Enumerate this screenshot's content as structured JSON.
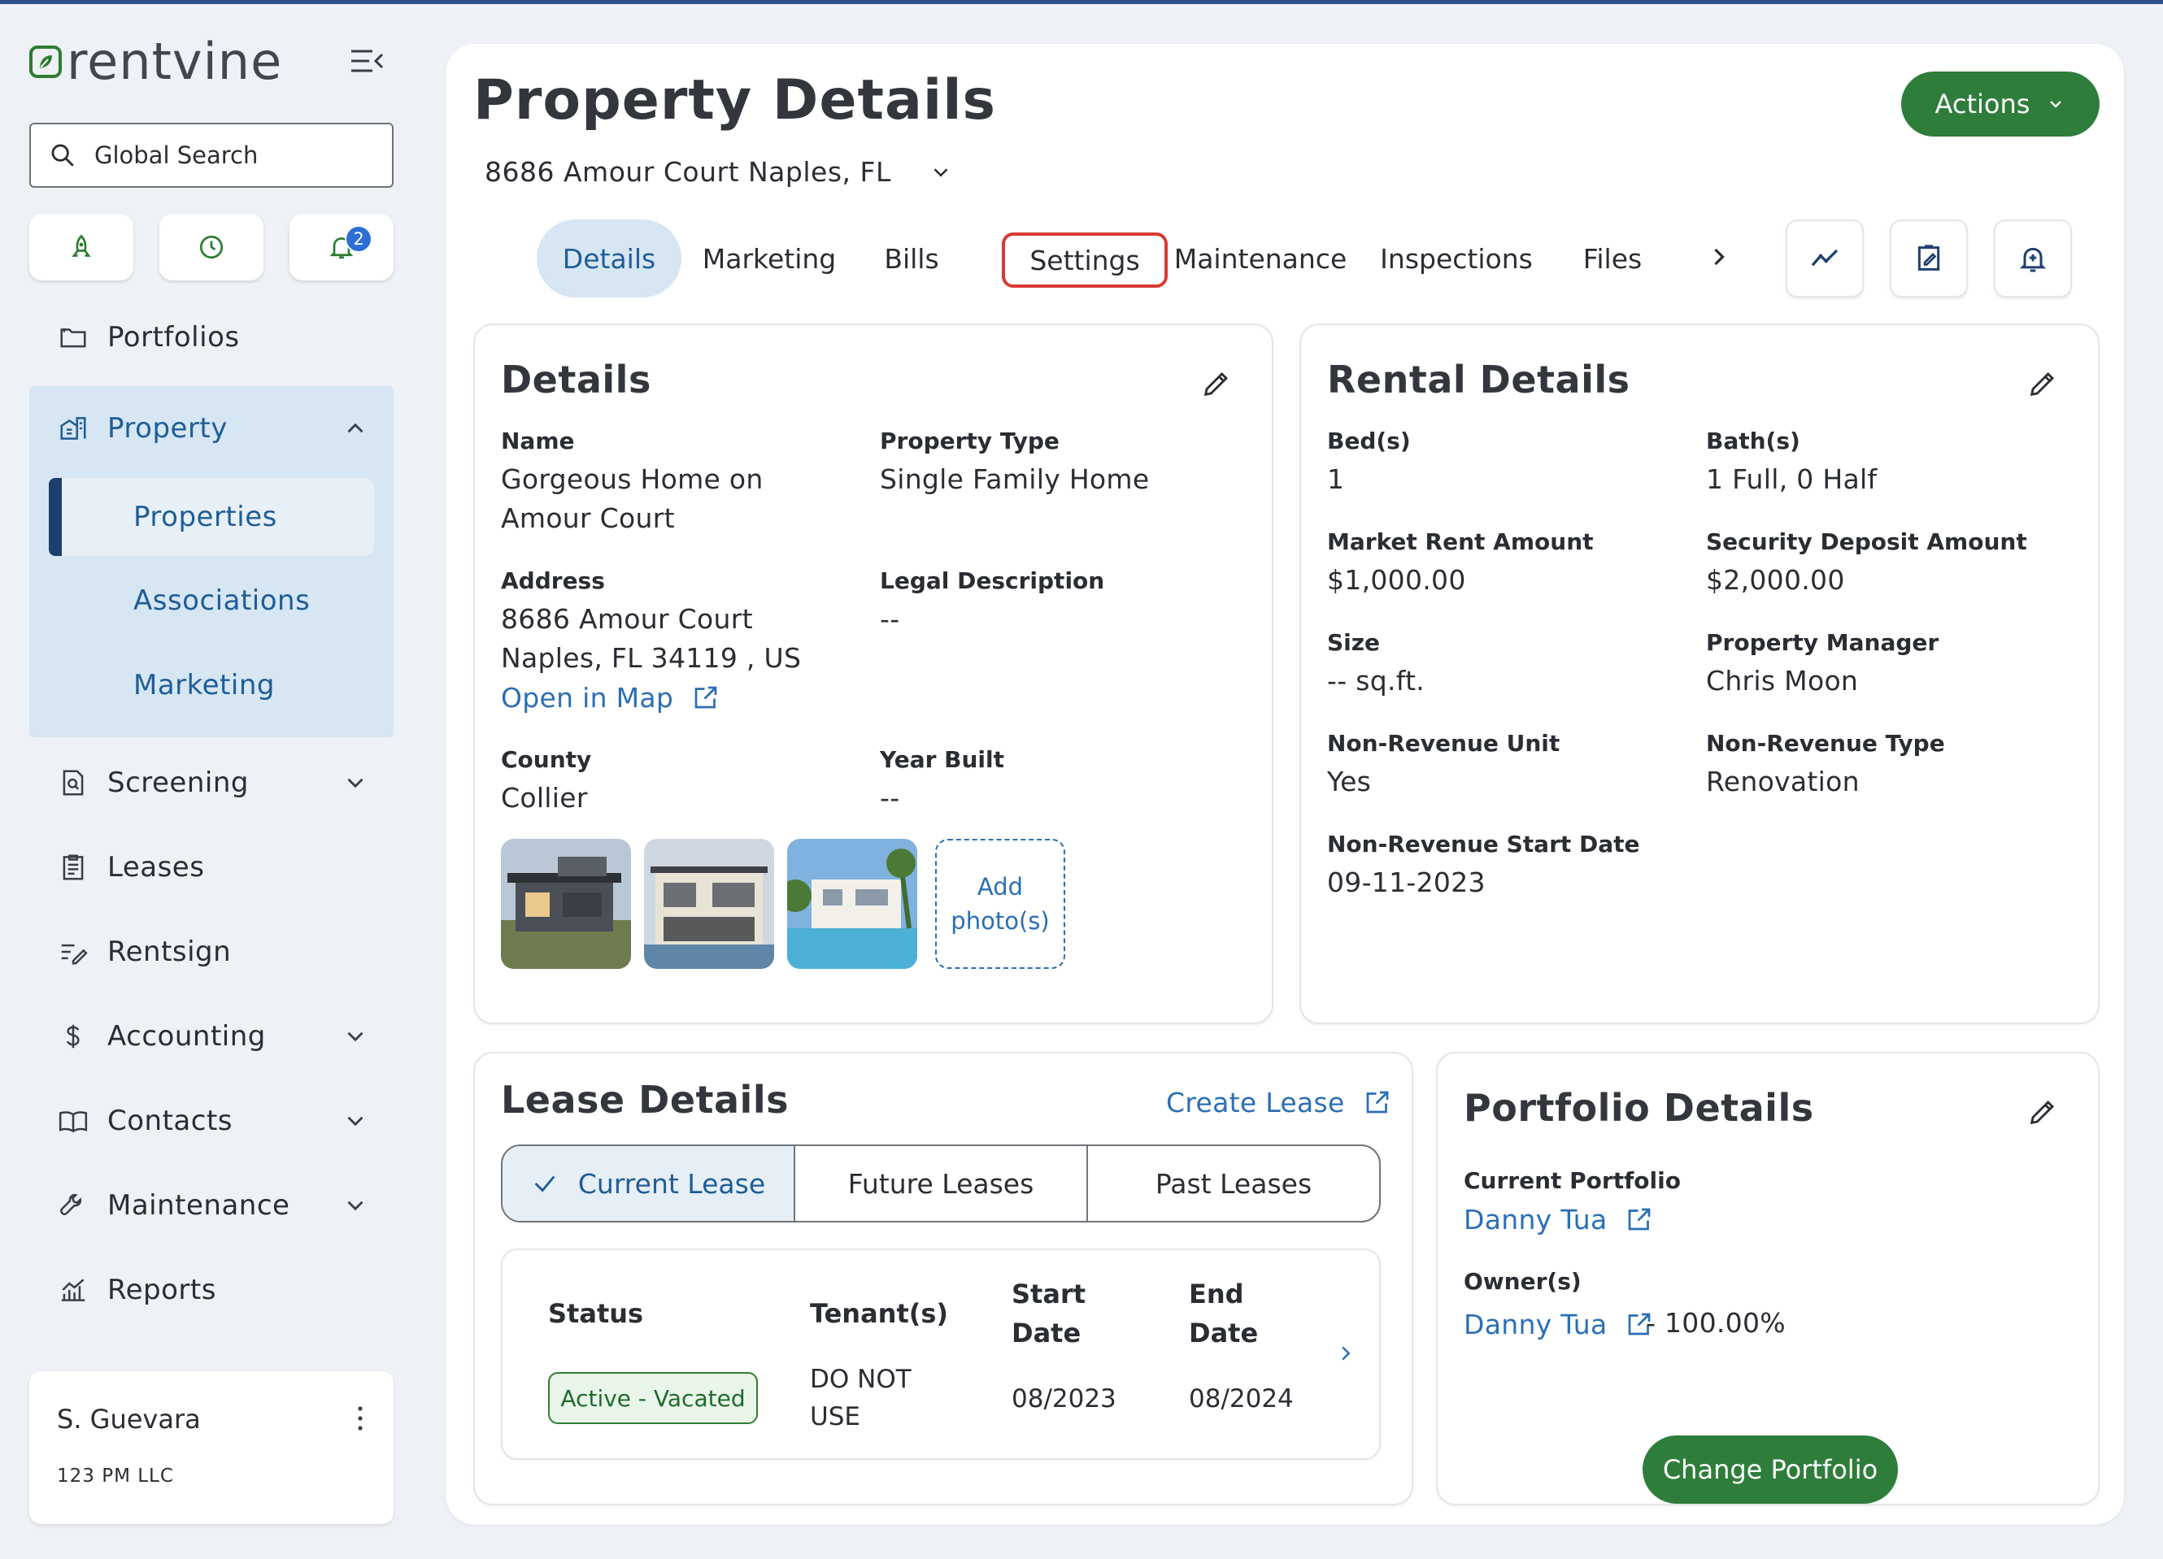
{
  "app": {
    "brand": "rentvine",
    "brand_color": "#2e7d32",
    "accent_color": "#2b6fb5"
  },
  "sidebar": {
    "search_label": "Global Search",
    "notification_count": "2",
    "nav": {
      "portfolios": "Portfolios",
      "property": "Property",
      "properties": "Properties",
      "associations": "Associations",
      "marketing": "Marketing",
      "screening": "Screening",
      "leases": "Leases",
      "rentsign": "Rentsign",
      "accounting": "Accounting",
      "contacts": "Contacts",
      "maintenance": "Maintenance",
      "reports": "Reports"
    },
    "user": {
      "name": "S. Guevara",
      "org": "123 PM LLC"
    }
  },
  "header": {
    "title": "Property Details",
    "address": "8686 Amour Court Naples, FL",
    "actions_label": "Actions"
  },
  "tabs": {
    "details": "Details",
    "marketing": "Marketing",
    "bills": "Bills",
    "settings": "Settings",
    "maintenance": "Maintenance",
    "inspections": "Inspections",
    "files": "Files"
  },
  "details_card": {
    "title": "Details",
    "name_label": "Name",
    "name_value": "Gorgeous Home on Amour Court",
    "type_label": "Property Type",
    "type_value": "Single Family Home",
    "address_label": "Address",
    "address_line1": "8686 Amour Court",
    "address_line2": "Naples, FL 34119 , US",
    "map_link": "Open in Map",
    "legal_label": "Legal Description",
    "legal_value": "--",
    "county_label": "County",
    "county_value": "Collier",
    "year_label": "Year Built",
    "year_value": "--",
    "add_photo": "Add photo(s)"
  },
  "rental_card": {
    "title": "Rental Details",
    "beds_label": "Bed(s)",
    "beds_value": "1",
    "baths_label": "Bath(s)",
    "baths_value": "1 Full, 0 Half",
    "rent_label": "Market Rent Amount",
    "rent_value": "$1,000.00",
    "deposit_label": "Security Deposit Amount",
    "deposit_value": "$2,000.00",
    "size_label": "Size",
    "size_value": "-- sq.ft.",
    "manager_label": "Property Manager",
    "manager_value": "Chris Moon",
    "nonrev_unit_label": "Non-Revenue Unit",
    "nonrev_unit_value": "Yes",
    "nonrev_type_label": "Non-Revenue Type",
    "nonrev_type_value": "Renovation",
    "nonrev_start_label": "Non-Revenue Start Date",
    "nonrev_start_value": "09-11-2023"
  },
  "lease_card": {
    "title": "Lease Details",
    "create_link": "Create Lease",
    "tab_current": "Current Lease",
    "tab_future": "Future Leases",
    "tab_past": "Past Leases",
    "col_status": "Status",
    "col_tenants": "Tenant(s)",
    "col_start": "Start Date",
    "col_end": "End Date",
    "row": {
      "status": "Active - Vacated",
      "tenants": "DO NOT USE",
      "start": "08/2023",
      "end": "08/2024"
    }
  },
  "portfolio_card": {
    "title": "Portfolio Details",
    "current_label": "Current Portfolio",
    "current_value": "Danny Tua",
    "owners_label": "Owner(s)",
    "owner_name": "Danny Tua",
    "owner_share": "- 100.00%",
    "change_label": "Change Portfolio"
  }
}
